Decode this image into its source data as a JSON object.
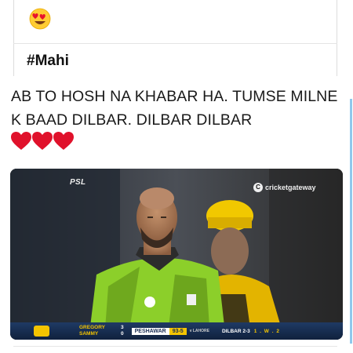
{
  "post": {
    "reaction_emoji": "heart-eyes",
    "hashtag": "#Mahi",
    "text": "AB TO HOSH NA KHABAR HA. TUMSE MILNE K BAAD DILBAR. DILBAR DILBAR",
    "hearts": [
      "heart",
      "heart",
      "heart"
    ]
  },
  "video": {
    "broadcaster_logo": "PSL",
    "watermark": "cricketgateway",
    "scorecard": {
      "batters": [
        "GREGORY",
        "SAMMY"
      ],
      "batter_runs": [
        "3",
        "0"
      ],
      "batting_team": "PESHAWAR",
      "score": "93-5",
      "opponent": "v LAHORE",
      "bowler": "DILBAR 2-3",
      "over_balls": "1 . W . 2"
    }
  },
  "colors": {
    "accent": "#8fc8ec",
    "heart": "#e0112b",
    "jersey_green": "#8ccf2a",
    "score_yellow": "#f4c400"
  }
}
